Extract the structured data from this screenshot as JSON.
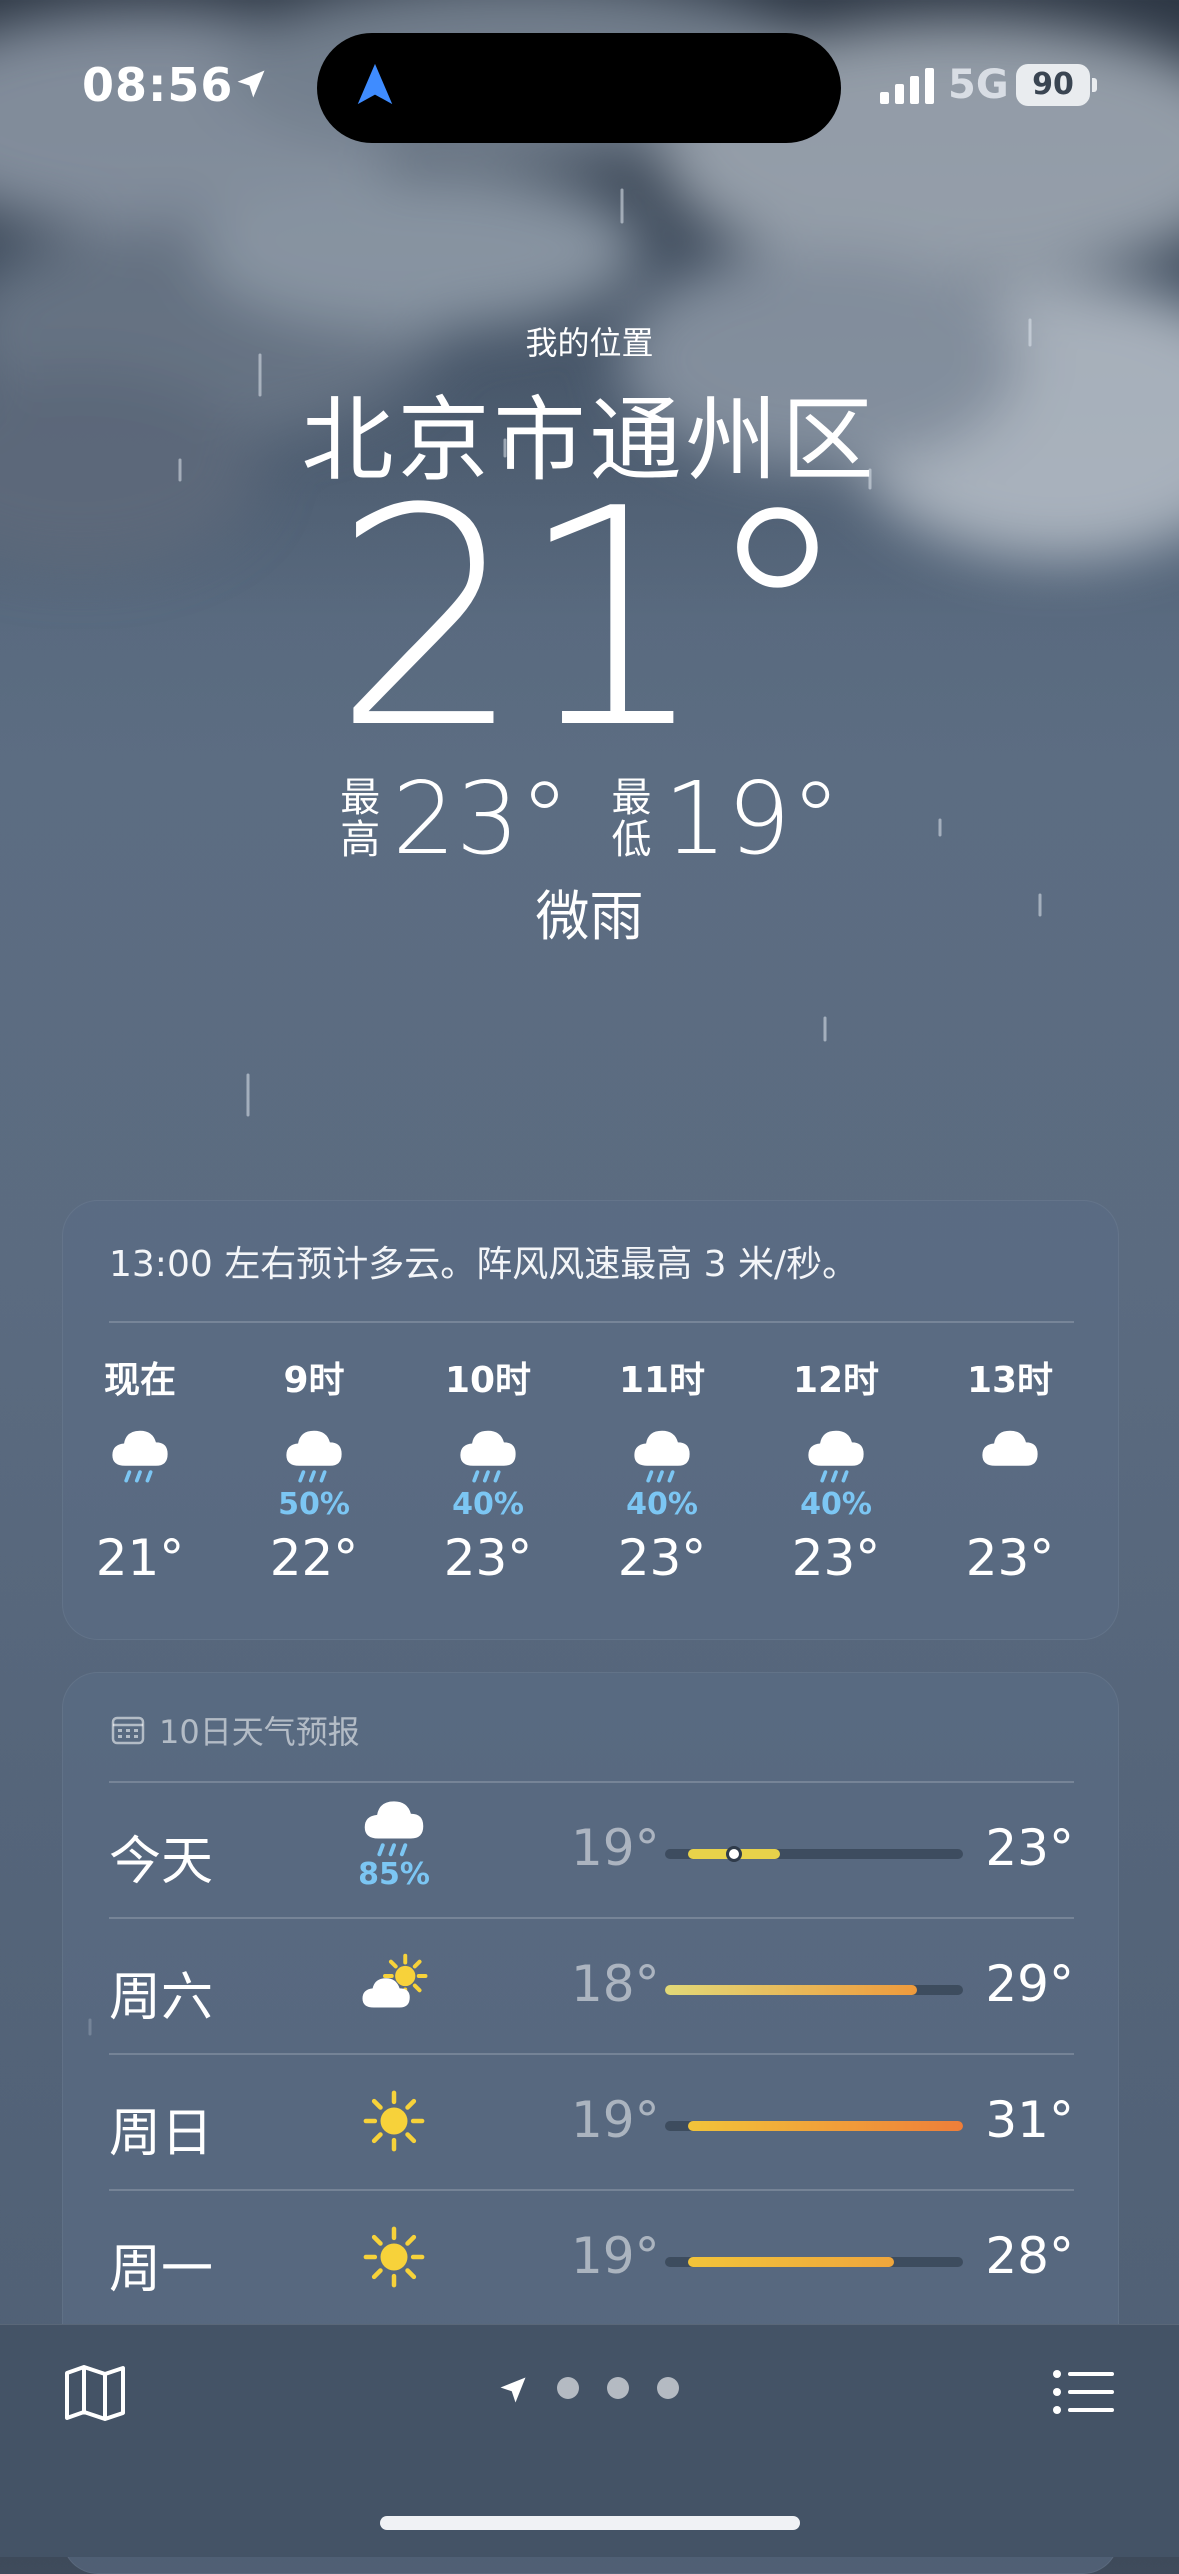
{
  "status_bar": {
    "time": "08:56",
    "network": "5G",
    "battery": "90"
  },
  "header": {
    "my_location": "我的位置",
    "city": "北京市通州区",
    "temperature": "21°",
    "high_label": "最高",
    "high": "23°",
    "low_label": "最低",
    "low": "19°",
    "condition": "微雨"
  },
  "hourly": {
    "summary": "13:00 左右预计多云。阵风风速最高 3 米/秒。",
    "items": [
      {
        "label": "现在",
        "icon": "rain-cloud-icon",
        "precip": "",
        "temp": "21°"
      },
      {
        "label": "9时",
        "icon": "rain-cloud-icon",
        "precip": "50%",
        "temp": "22°"
      },
      {
        "label": "10时",
        "icon": "rain-cloud-icon",
        "precip": "40%",
        "temp": "23°"
      },
      {
        "label": "11时",
        "icon": "rain-cloud-icon",
        "precip": "40%",
        "temp": "23°"
      },
      {
        "label": "12时",
        "icon": "rain-cloud-icon",
        "precip": "40%",
        "temp": "23°"
      },
      {
        "label": "13时",
        "icon": "cloud-icon",
        "precip": "",
        "temp": "23°"
      }
    ]
  },
  "daily": {
    "title": "10日天气预报",
    "range_min": 18,
    "range_max": 31,
    "days": [
      {
        "name": "今天",
        "icon": "rain-cloud-icon",
        "precip": "85%",
        "low": "19°",
        "high": "23°",
        "low_value": 19,
        "high_value": 23,
        "current_value": 21,
        "colors": [
          "#e8d24a",
          "#e8d24a"
        ]
      },
      {
        "name": "周六",
        "icon": "partly-sunny-icon",
        "precip": "",
        "low": "18°",
        "high": "29°",
        "low_value": 18,
        "high_value": 29,
        "colors": [
          "#e2d978",
          "#ee9a3c"
        ]
      },
      {
        "name": "周日",
        "icon": "sun-icon",
        "precip": "",
        "low": "19°",
        "high": "31°",
        "low_value": 19,
        "high_value": 31,
        "colors": [
          "#f2c43a",
          "#ee7e3a"
        ]
      },
      {
        "name": "周一",
        "icon": "sun-icon",
        "precip": "",
        "low": "19°",
        "high": "28°",
        "low_value": 19,
        "high_value": 28,
        "colors": [
          "#f2c43a",
          "#efa63c"
        ]
      }
    ]
  },
  "bottom_bar": {
    "map_icon": "map-icon",
    "location_icon": "location-arrow-icon",
    "page_dots": 3,
    "list_icon": "list-icon"
  }
}
